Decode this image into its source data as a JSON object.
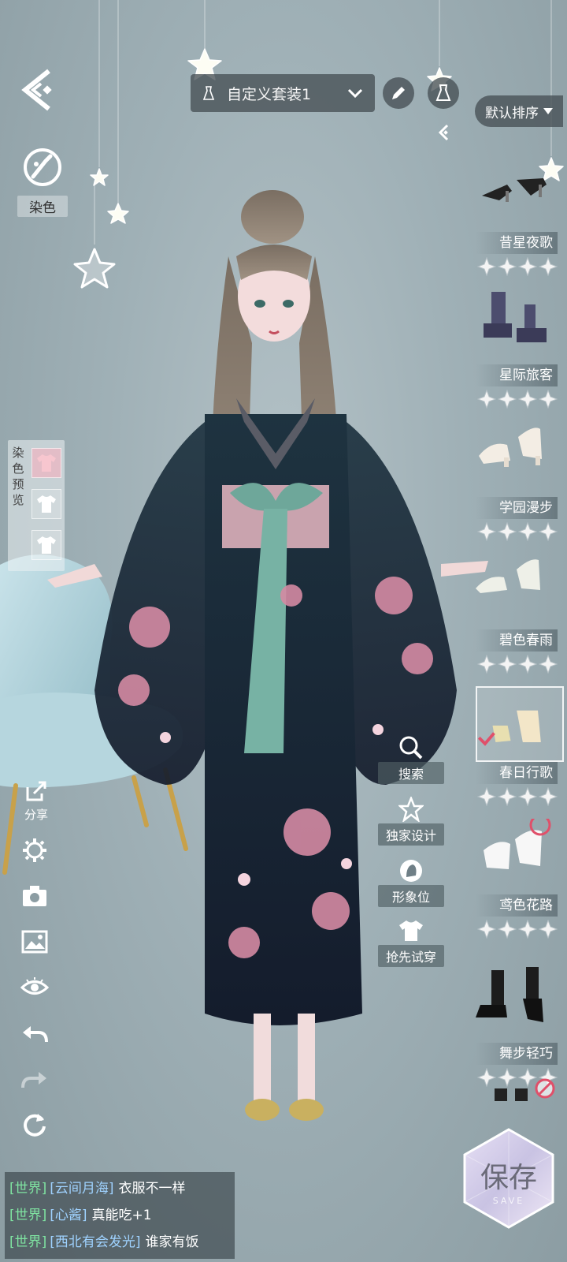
{
  "header": {
    "outfit_name": "自定义套装1",
    "sort_label": "默认排序"
  },
  "left_tools": {
    "dye_label": "染色",
    "dye_preview_label": "染色预览",
    "share_label": "分享"
  },
  "items": [
    {
      "name": "昔星夜歌",
      "rating_stars": 4,
      "selected": false
    },
    {
      "name": "星际旅客",
      "rating_stars": 4,
      "selected": false
    },
    {
      "name": "学园漫步",
      "rating_stars": 4,
      "selected": false
    },
    {
      "name": "碧色春雨",
      "rating_stars": 4,
      "selected": false
    },
    {
      "name": "春日行歌",
      "rating_stars": 4,
      "selected": true
    },
    {
      "name": "鸢色花路",
      "rating_stars": 4,
      "selected": false
    },
    {
      "name": "舞步轻巧",
      "rating_stars": 4,
      "selected": false
    }
  ],
  "actions": {
    "search_label": "搜索",
    "exclusive_label": "独家设计",
    "image_slot_label": "形象位",
    "try_on_label": "抢先试穿"
  },
  "save": {
    "label": "保存",
    "sub_label": "SAVE"
  },
  "chat": [
    {
      "channel": "[世界]",
      "user": "[云间月海]",
      "message": "衣服不一样"
    },
    {
      "channel": "[世界]",
      "user": "[心酱]",
      "message": "真能吃+1"
    },
    {
      "channel": "[世界]",
      "user": "[西北有会发光]",
      "message": "谁家有饭"
    }
  ],
  "colors": {
    "accent": "#7fe3a1",
    "username": "#9fd2ff",
    "panel": "#465054"
  }
}
